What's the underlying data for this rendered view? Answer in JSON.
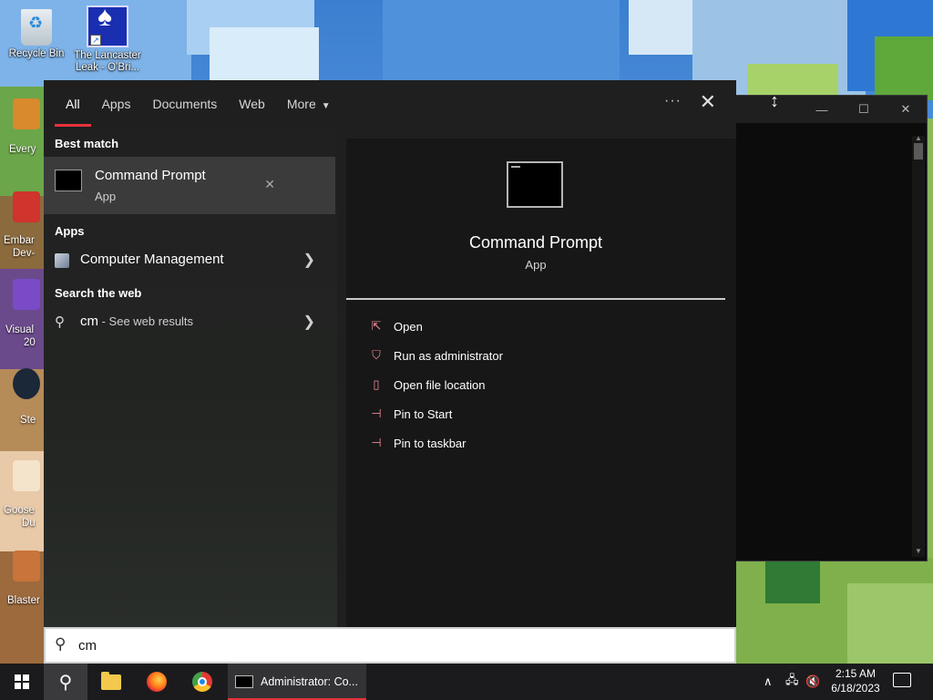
{
  "desktop": {
    "icons": [
      {
        "label_line1": "Recycle Bin",
        "label_line2": ""
      },
      {
        "label_line1": "The Lancaster",
        "label_line2": "Leak - O'Bri..."
      }
    ],
    "partial_labels": [
      "Every",
      "Embar",
      "Dev-",
      "Visual",
      "20",
      "Ste",
      "Goose",
      "Du",
      "Blaster"
    ]
  },
  "search_panel": {
    "tabs": [
      {
        "label": "All",
        "active": true
      },
      {
        "label": "Apps",
        "active": false
      },
      {
        "label": "Documents",
        "active": false
      },
      {
        "label": "Web",
        "active": false
      },
      {
        "label": "More",
        "active": false
      }
    ],
    "more_menu_icon": "ellipsis-icon",
    "close_icon": "close-icon",
    "best_match": {
      "section_title": "Best match",
      "name": "Command Prompt",
      "type": "App"
    },
    "apps": {
      "section_title": "Apps",
      "items": [
        {
          "label": "Computer Management"
        }
      ]
    },
    "web": {
      "section_title": "Search the web",
      "query": "cm",
      "hint": " - See web results"
    },
    "preview": {
      "name": "Command Prompt",
      "type": "App",
      "actions": [
        {
          "label": "Open",
          "icon": "open-icon"
        },
        {
          "label": "Run as administrator",
          "icon": "shield-icon"
        },
        {
          "label": "Open file location",
          "icon": "file-location-icon"
        },
        {
          "label": "Pin to Start",
          "icon": "pin-icon"
        },
        {
          "label": "Pin to taskbar",
          "icon": "pin-icon"
        }
      ]
    },
    "search_box": {
      "value": "cm",
      "placeholder": ""
    }
  },
  "taskbar": {
    "active_task_label": "Administrator:  Co...",
    "clock_time": "2:15 AM",
    "clock_date": "6/18/2023"
  },
  "colors": {
    "accent": "#e8313b",
    "panel_bg": "#1f1f1f",
    "selected_bg": "#3b3b3b",
    "action_icon": "#f08a9a"
  }
}
